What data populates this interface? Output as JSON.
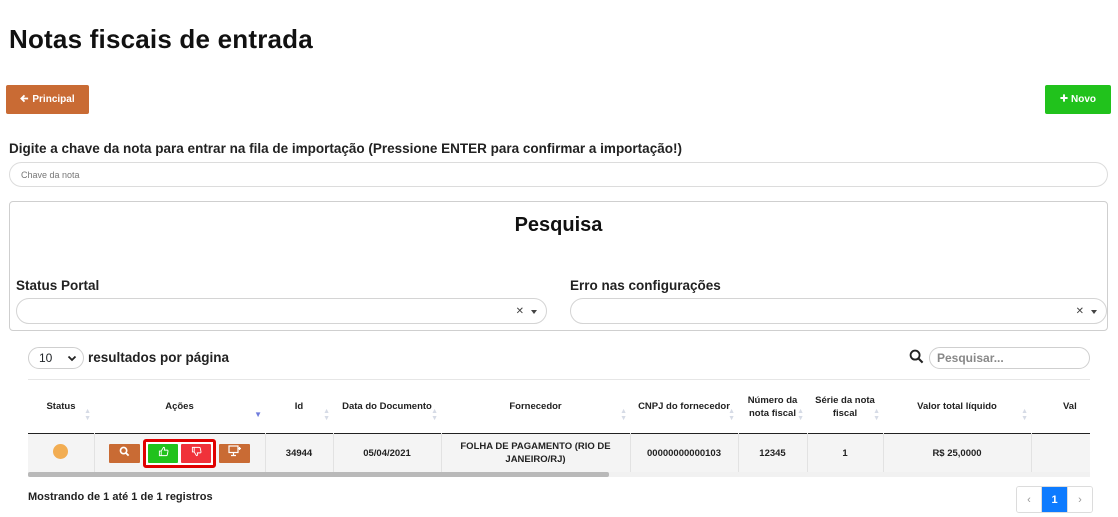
{
  "header": {
    "title": "Notas fiscais de entrada"
  },
  "toolbar": {
    "principal_label": "Principal",
    "novo_label": "Novo"
  },
  "import": {
    "label": "Digite a chave da nota para entrar na fila de importação (Pressione ENTER para confirmar a importação!)",
    "placeholder": "Chave da nota"
  },
  "search_panel": {
    "title": "Pesquisa",
    "filters": [
      {
        "label": "Status Portal",
        "value": ""
      },
      {
        "label": "Erro nas configurações",
        "value": ""
      }
    ]
  },
  "table_controls": {
    "page_length": "10",
    "page_length_label": "resultados por página",
    "search_placeholder": "Pesquisar..."
  },
  "table": {
    "columns": [
      "Status",
      "Ações",
      "Id",
      "Data do Documento",
      "Fornecedor",
      "CNPJ do fornecedor",
      "Número da nota fiscal",
      "Série da nota fiscal",
      "Valor total líquido",
      "Val"
    ],
    "rows": [
      {
        "status_color": "#f2ad52",
        "id": "34944",
        "data": "05/04/2021",
        "fornecedor": "FOLHA DE PAGAMENTO (RIO DE JANEIRO/RJ)",
        "cnpj": "00000000000103",
        "numero": "12345",
        "serie": "1",
        "valor": "R$ 25,0000"
      }
    ]
  },
  "footer": {
    "info": "Mostrando de 1 até 1 de 1 registros",
    "prev": "‹",
    "current_page": "1",
    "next": "›"
  },
  "colors": {
    "principal": "#c96b34",
    "novo": "#21c21c",
    "approve": "#21c21c",
    "reject": "#f0323a",
    "highlight": "#e00000",
    "page_active": "#0d7bff"
  }
}
